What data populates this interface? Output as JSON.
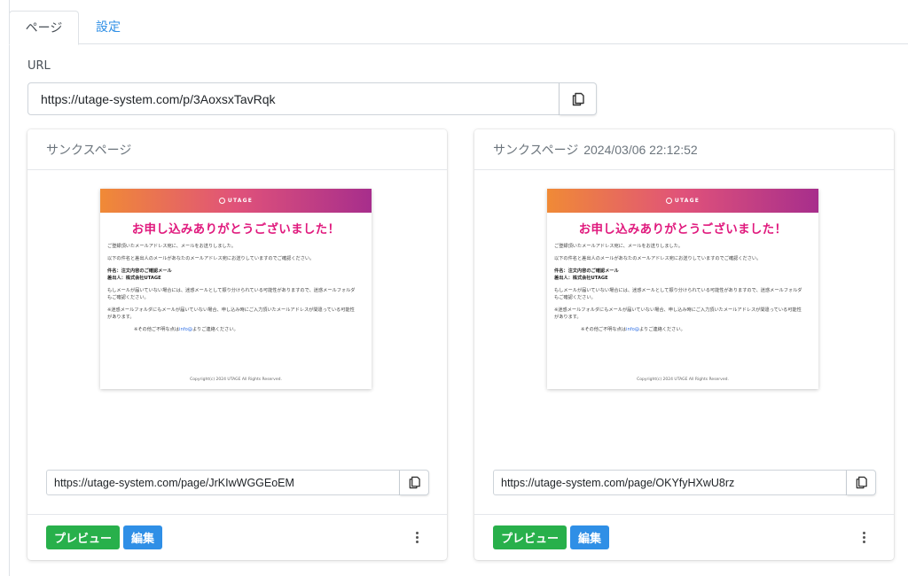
{
  "tabs": [
    {
      "label": "ページ",
      "active": true
    },
    {
      "label": "設定",
      "active": false
    }
  ],
  "url_section": {
    "label": "URL",
    "value": "https://utage-system.com/p/3AoxsxTavRqk"
  },
  "cards": [
    {
      "header": "サンクスページ",
      "timestamp": "",
      "url": "https://utage-system.com/page/JrKIwWGGEoEM",
      "preview_label": "プレビュー",
      "edit_label": "編集"
    },
    {
      "header": "サンクスページ",
      "timestamp": "2024/03/06 22:12:52",
      "url": "https://utage-system.com/page/OKYfyHXwU8rz",
      "preview_label": "プレビュー",
      "edit_label": "編集"
    }
  ],
  "thumbnail": {
    "brand": "UTAGE",
    "title": "お申し込みありがとうございました！",
    "para1": "ご登録頂いたメールアドレス宛に、メールをお送りしました。",
    "para2": "以下の件名と差出人のメールがあなたのメールアドレス宛にお送りしていますのでご確認ください。",
    "subject": "件名：注文内容のご確認メール",
    "sender": "差出人：株式会社UTAGE",
    "para3": "もしメールが届いていない場合には、迷惑メールとして振り分けられている可能性がありますので、迷惑メールフォルダもご確認ください。",
    "para4": "※迷惑メールフォルダにもメールが届いていない場合、申し込み時にご入力頂いたメールアドレスが間違っている可能性があります。",
    "para5_pre": "※その他ご不明な点は",
    "para5_link": "info@",
    "para5_post": "よりご連絡ください。",
    "copyright": "Copyright(c) 2024 UTAGE All Rights Reserved."
  },
  "colors": {
    "tab_link": "#2f8fe6",
    "preview_button": "#28b04b",
    "edit_button": "#2f8fe6",
    "thumb_title": "#e0197d"
  },
  "icons": {
    "copy": "copy-icon",
    "menu": "kebab-menu-icon"
  }
}
